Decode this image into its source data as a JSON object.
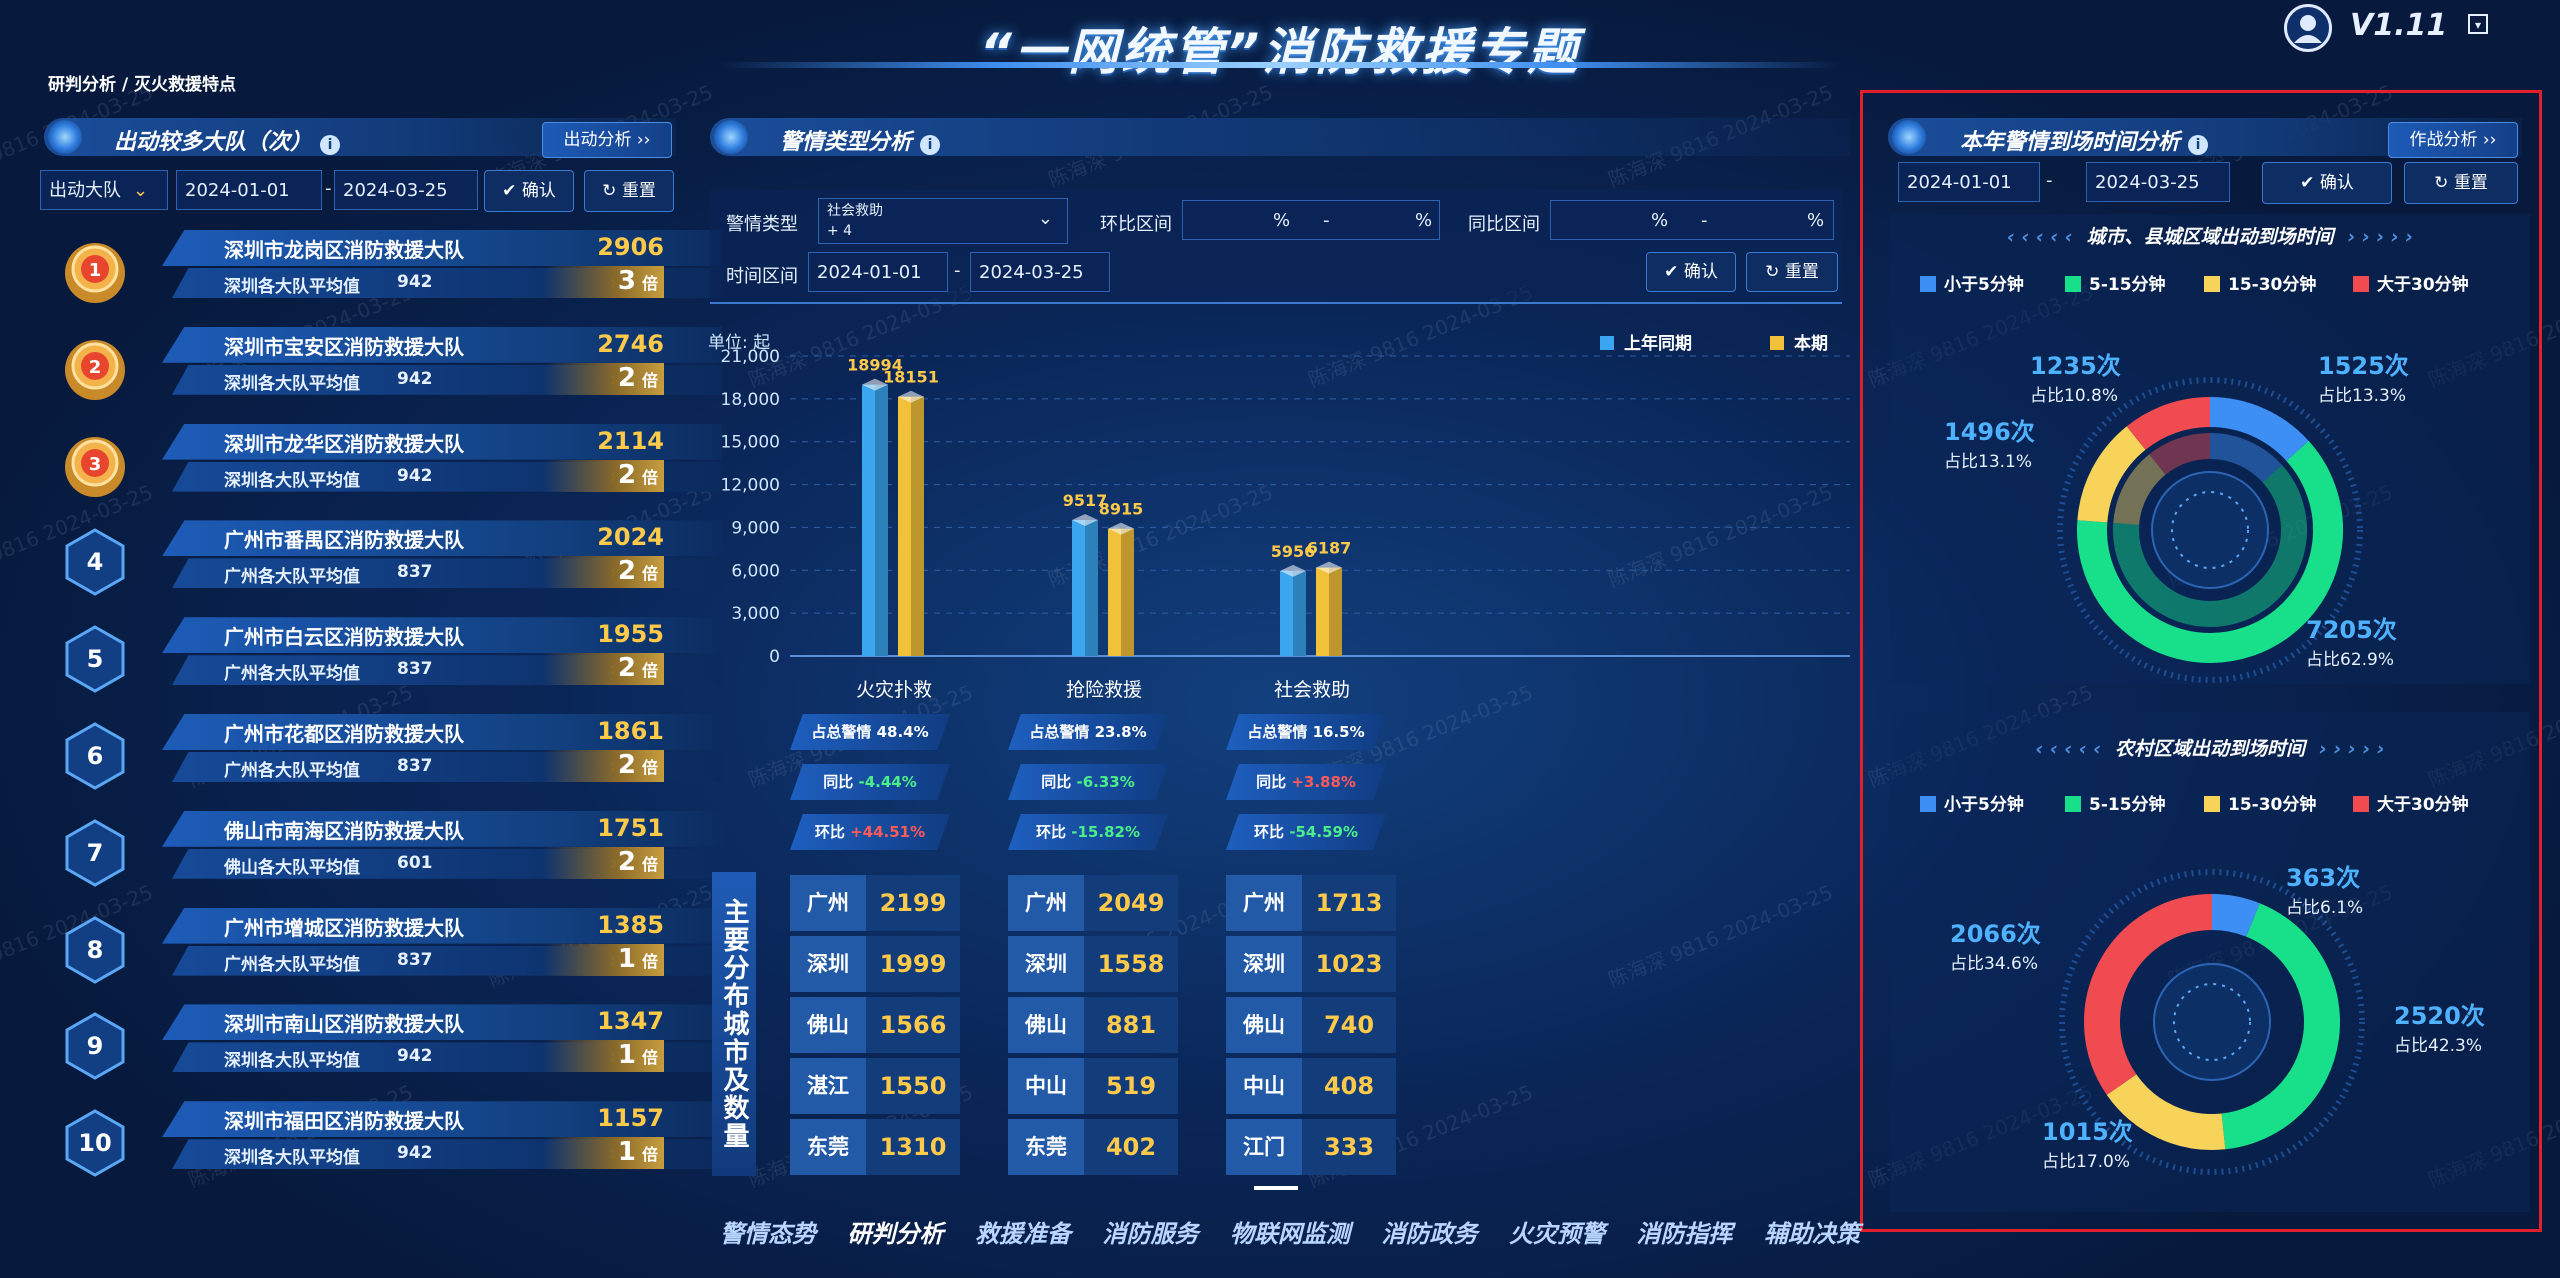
{
  "header": {
    "title": "“一网统管”消防救援专题",
    "version": "V1.11",
    "breadcrumb": "研判分析 / 灭火救援特点"
  },
  "left": {
    "title": "出动较多大队（次）",
    "action_btn": "出动分析",
    "filter_select": "出动大队",
    "date_start": "2024-01-01",
    "date_sep": "-",
    "date_end": "2024-03-25",
    "confirm": "确认",
    "reset": "重置",
    "ranks": [
      {
        "rank": "1",
        "name": "深圳市龙岗区消防救援大队",
        "value": "2906",
        "avg_label": "深圳各大队平均值",
        "avg": "942",
        "mult": "3",
        "unit": "倍"
      },
      {
        "rank": "2",
        "name": "深圳市宝安区消防救援大队",
        "value": "2746",
        "avg_label": "深圳各大队平均值",
        "avg": "942",
        "mult": "2",
        "unit": "倍"
      },
      {
        "rank": "3",
        "name": "深圳市龙华区消防救援大队",
        "value": "2114",
        "avg_label": "深圳各大队平均值",
        "avg": "942",
        "mult": "2",
        "unit": "倍"
      },
      {
        "rank": "4",
        "name": "广州市番禺区消防救援大队",
        "value": "2024",
        "avg_label": "广州各大队平均值",
        "avg": "837",
        "mult": "2",
        "unit": "倍"
      },
      {
        "rank": "5",
        "name": "广州市白云区消防救援大队",
        "value": "1955",
        "avg_label": "广州各大队平均值",
        "avg": "837",
        "mult": "2",
        "unit": "倍"
      },
      {
        "rank": "6",
        "name": "广州市花都区消防救援大队",
        "value": "1861",
        "avg_label": "广州各大队平均值",
        "avg": "837",
        "mult": "2",
        "unit": "倍"
      },
      {
        "rank": "7",
        "name": "佛山市南海区消防救援大队",
        "value": "1751",
        "avg_label": "佛山各大队平均值",
        "avg": "601",
        "mult": "2",
        "unit": "倍"
      },
      {
        "rank": "8",
        "name": "广州市增城区消防救援大队",
        "value": "1385",
        "avg_label": "广州各大队平均值",
        "avg": "837",
        "mult": "1",
        "unit": "倍"
      },
      {
        "rank": "9",
        "name": "深圳市南山区消防救援大队",
        "value": "1347",
        "avg_label": "深圳各大队平均值",
        "avg": "942",
        "mult": "1",
        "unit": "倍"
      },
      {
        "rank": "10",
        "name": "深圳市福田区消防救援大队",
        "value": "1157",
        "avg_label": "深圳各大队平均值",
        "avg": "942",
        "mult": "1",
        "unit": "倍"
      }
    ]
  },
  "middle": {
    "title": "警情类型分析",
    "type_label": "警情类型",
    "type_value": "社会救助",
    "type_more": "+ 4",
    "hb_label": "环比区间",
    "tb_label": "同比区间",
    "pct": "%",
    "dash": "-",
    "time_label": "时间区间",
    "date_start": "2024-01-01",
    "date_end": "2024-03-25",
    "confirm": "确认",
    "reset": "重置",
    "city_title": "主要分布城市及数量",
    "cats": [
      {
        "share_label": "占总警情",
        "share": "48.4%",
        "tb_label": "同比",
        "tb": "-4.44%",
        "tb_dir": "dn",
        "hb_label": "环比",
        "hb": "+44.51%",
        "hb_dir": "up",
        "cities": [
          {
            "c": "广州",
            "v": "2199"
          },
          {
            "c": "深圳",
            "v": "1999"
          },
          {
            "c": "佛山",
            "v": "1566"
          },
          {
            "c": "湛江",
            "v": "1550"
          },
          {
            "c": "东莞",
            "v": "1310"
          }
        ]
      },
      {
        "share_label": "占总警情",
        "share": "23.8%",
        "tb_label": "同比",
        "tb": "-6.33%",
        "tb_dir": "dn",
        "hb_label": "环比",
        "hb": "-15.82%",
        "hb_dir": "dn",
        "cities": [
          {
            "c": "广州",
            "v": "2049"
          },
          {
            "c": "深圳",
            "v": "1558"
          },
          {
            "c": "佛山",
            "v": "881"
          },
          {
            "c": "中山",
            "v": "519"
          },
          {
            "c": "东莞",
            "v": "402"
          }
        ]
      },
      {
        "share_label": "占总警情",
        "share": "16.5%",
        "tb_label": "同比",
        "tb": "+3.88%",
        "tb_dir": "up",
        "hb_label": "环比",
        "hb": "-54.59%",
        "hb_dir": "dn",
        "cities": [
          {
            "c": "广州",
            "v": "1713"
          },
          {
            "c": "深圳",
            "v": "1023"
          },
          {
            "c": "佛山",
            "v": "740"
          },
          {
            "c": "中山",
            "v": "408"
          },
          {
            "c": "江门",
            "v": "333"
          }
        ]
      }
    ]
  },
  "right": {
    "title": "本年警情到场时间分析",
    "action_btn": "作战分析",
    "date_start": "2024-01-01",
    "date_sep": "-",
    "date_end": "2024-03-25",
    "confirm": "确认",
    "reset": "重置",
    "urban_title": "城市、县城区域出动到场时间",
    "rural_title": "农村区域出动到场时间"
  },
  "nav": [
    "警情态势",
    "研判分析",
    "救援准备",
    "消防服务",
    "物联网监测",
    "消防政务",
    "火灾预警",
    "消防指挥",
    "辅助决策"
  ],
  "watermark": "陈海深 9816 2024-03-25",
  "chart_data": [
    {
      "type": "bar",
      "unit_label": "单位: 起",
      "categories": [
        "火灾扑救",
        "抢险救援",
        "社会救助"
      ],
      "series": [
        {
          "name": "上年同期",
          "values": [
            18994,
            9517,
            5956
          ],
          "color": "#3aa6f0"
        },
        {
          "name": "本期",
          "values": [
            18151,
            8915,
            6187
          ],
          "color": "#f2c13a"
        }
      ],
      "yticks": [
        "0",
        "3,000",
        "6,000",
        "9,000",
        "12,000",
        "15,000",
        "18,000",
        "21,000"
      ],
      "ylim": [
        0,
        21000
      ]
    },
    {
      "type": "pie",
      "title": "城市、县城区域出动到场时间",
      "legend": [
        "小于5分钟",
        "5-15分钟",
        "15-30分钟",
        "大于30分钟"
      ],
      "colors": [
        "#3d8ef5",
        "#18e08a",
        "#f7d35a",
        "#f04b50"
      ],
      "values": [
        1525,
        7205,
        1496,
        1235
      ],
      "labels": [
        {
          "count": "1525次",
          "pct": "占比13.3%"
        },
        {
          "count": "7205次",
          "pct": "占比62.9%"
        },
        {
          "count": "1496次",
          "pct": "占比13.1%"
        },
        {
          "count": "1235次",
          "pct": "占比10.8%"
        }
      ]
    },
    {
      "type": "pie",
      "title": "农村区域出动到场时间",
      "legend": [
        "小于5分钟",
        "5-15分钟",
        "15-30分钟",
        "大于30分钟"
      ],
      "colors": [
        "#3d8ef5",
        "#18e08a",
        "#f7d35a",
        "#f04b50"
      ],
      "values": [
        363,
        2520,
        1015,
        2066
      ],
      "labels": [
        {
          "count": "363次",
          "pct": "占比6.1%"
        },
        {
          "count": "2520次",
          "pct": "占比42.3%"
        },
        {
          "count": "1015次",
          "pct": "占比17.0%"
        },
        {
          "count": "2066次",
          "pct": "占比34.6%"
        }
      ]
    }
  ]
}
